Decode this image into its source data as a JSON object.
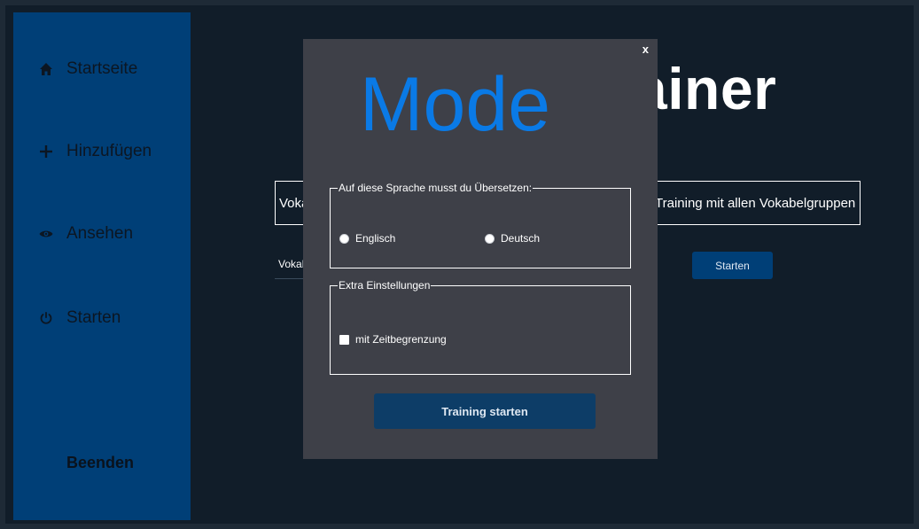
{
  "sidebar": {
    "items": [
      {
        "label": "Startseite",
        "icon": "home-icon"
      },
      {
        "label": "Hinzufügen",
        "icon": "plus-icon"
      },
      {
        "label": "Ansehen",
        "icon": "eye-icon"
      },
      {
        "label": "Starten",
        "icon": "power-icon"
      }
    ],
    "quit_label": "Beenden"
  },
  "main": {
    "title_fragment": "ainer",
    "left_box_text": "Voka",
    "right_box_text": "Training mit allen Vokabelgruppen",
    "group_label_fragment": "Vokal",
    "start_button": "Starten"
  },
  "modal": {
    "close_label": "x",
    "title": "Mode",
    "language_group": {
      "legend": "Auf diese Sprache musst du Übersetzen:",
      "options": [
        "Englisch",
        "Deutsch"
      ]
    },
    "extra_group": {
      "legend": "Extra Einstellungen",
      "checkbox_label": "mit Zeitbegrenzung"
    },
    "submit_label": "Training starten"
  },
  "colors": {
    "sidebar": "#003f77",
    "background": "#111d29",
    "modal": "#3e4048",
    "accent": "#0a7ae6",
    "button": "#0d3d67"
  }
}
